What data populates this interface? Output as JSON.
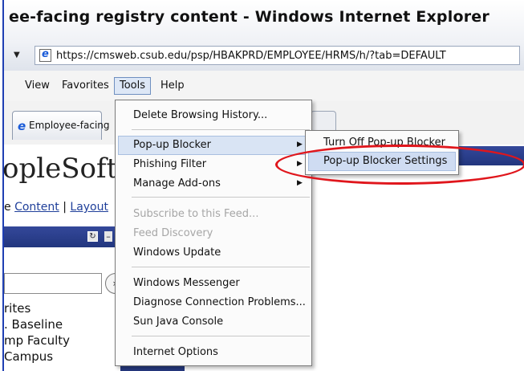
{
  "window": {
    "title": "ee-facing registry content - Windows Internet Explorer"
  },
  "address_bar": {
    "url": "https://cmsweb.csub.edu/psp/HBAKPRD/EMPLOYEE/HRMS/h/?tab=DEFAULT"
  },
  "menu_bar": {
    "items": [
      "View",
      "Favorites",
      "Tools",
      "Help"
    ]
  },
  "tab": {
    "label": "Employee-facing"
  },
  "page": {
    "brand": "opleSoft.",
    "links_prefix": "e ",
    "link_content": "Content",
    "link_separator": " | ",
    "link_layout": "Layout",
    "side_links": [
      "rites",
      ". Baseline",
      "mp Faculty",
      "Campus"
    ]
  },
  "tools_menu": {
    "delete_history": "Delete Browsing History...",
    "popup_blocker": "Pop-up Blocker",
    "phishing_filter": "Phishing Filter",
    "manage_addons": "Manage Add-ons",
    "subscribe_feed": "Subscribe to this Feed...",
    "feed_discovery": "Feed Discovery",
    "windows_update": "Windows Update",
    "windows_messenger": "Windows Messenger",
    "diagnose": "Diagnose Connection Problems...",
    "sun_java": "Sun Java Console",
    "internet_options": "Internet Options"
  },
  "popup_submenu": {
    "turn_off": "Turn Off Pop-up Blocker",
    "settings": "Pop-up Blocker Settings"
  },
  "colors": {
    "highlight_oval": "#e0161c",
    "menu_highlight": "#d9e4f4",
    "portal_blue": "#22367e"
  }
}
